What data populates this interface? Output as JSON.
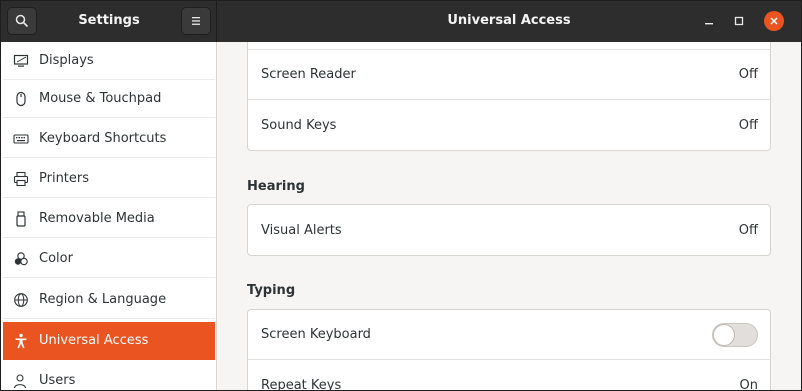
{
  "header": {
    "left_title": "Settings",
    "title": "Universal Access",
    "icons": [
      "search-icon",
      "hamburger-menu-icon",
      "minimize-icon",
      "maximize-icon",
      "close-icon"
    ],
    "accent": "#e95420"
  },
  "sidebar": {
    "items": [
      {
        "label": "Displays",
        "icon": "display-icon"
      },
      {
        "label": "Mouse & Touchpad",
        "icon": "mouse-icon"
      },
      {
        "label": "Keyboard Shortcuts",
        "icon": "keyboard-icon"
      },
      {
        "label": "Printers",
        "icon": "printer-icon"
      },
      {
        "label": "Removable Media",
        "icon": "usb-drive-icon"
      },
      {
        "label": "Color",
        "icon": "color-icon"
      },
      {
        "label": "Region & Language",
        "icon": "globe-icon"
      },
      {
        "label": "Universal Access",
        "icon": "accessibility-icon",
        "active": true
      },
      {
        "label": "Users",
        "icon": "users-icon"
      }
    ]
  },
  "content": {
    "seeing_rows": [
      {
        "name": "Screen Reader",
        "value": "Off"
      },
      {
        "name": "Sound Keys",
        "value": "Off"
      }
    ],
    "hearing": {
      "title": "Hearing",
      "rows": [
        {
          "name": "Visual Alerts",
          "value": "Off"
        }
      ]
    },
    "typing": {
      "title": "Typing",
      "rows": [
        {
          "name": "Screen Keyboard",
          "switch_on": false
        },
        {
          "name": "Repeat Keys",
          "value": "On"
        }
      ]
    }
  }
}
